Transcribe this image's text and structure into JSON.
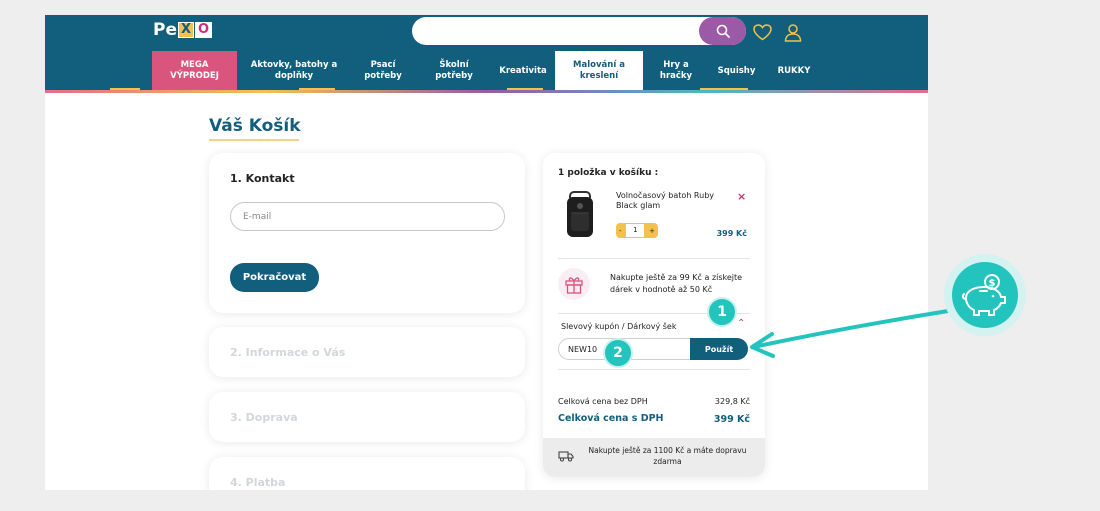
{
  "brand": {
    "logo_p": "Pe",
    "logo_x": "X",
    "logo_o": "O",
    "colors": {
      "primary": "#115e7d",
      "accent_pink": "#d9557d",
      "search_purple": "#9b5aa5",
      "yellow": "#f2c14e",
      "annotation_teal": "#24c4be"
    }
  },
  "header": {
    "search": {
      "placeholder": "",
      "icon": "search-icon"
    },
    "icons": [
      "heart-icon",
      "user-icon"
    ]
  },
  "nav": {
    "items": [
      {
        "label": "MEGA\nVÝPRODEJ"
      },
      {
        "label": "Aktovky, batohy a\ndoplňky"
      },
      {
        "label": "Psací\npotřeby"
      },
      {
        "label": "Školní\npotřeby"
      },
      {
        "label": "Kreativita"
      },
      {
        "label": "Malování a\nkreslení"
      },
      {
        "label": "Hry a\nhračky"
      },
      {
        "label": "Squishy"
      },
      {
        "label": "RUKKY"
      }
    ],
    "active_index": 5
  },
  "page": {
    "title": "Váš Košík"
  },
  "checkout": {
    "contact": {
      "title": "1. Kontakt",
      "email_placeholder": "E-mail",
      "continue_label": "Pokračovat"
    },
    "steps": [
      {
        "title": "2. Informace o Vás"
      },
      {
        "title": "3. Doprava"
      },
      {
        "title": "4. Platba"
      }
    ]
  },
  "cart": {
    "heading": "1 položka v košíku :",
    "item": {
      "name": "Volnočasový batoh Ruby Black glam",
      "qty": "1",
      "minus": "-",
      "plus": "+",
      "price": "399 Kč",
      "remove": "×"
    },
    "gift_text": "Nakupte ještě za 99 Kč a získejte dárek v hodnotě až 50 Kč",
    "coupon": {
      "label": "Slevový kupón / Dárkový šek",
      "value": "NEW10",
      "apply_label": "Použít"
    },
    "summary": {
      "net_label": "Celková cena bez DPH",
      "net_value": "329,8 Kč",
      "total_label": "Celková cena s DPH",
      "total_value": "399 Kč"
    },
    "shipping_text": "Nakupte ještě za 1100 Kč a máte dopravu zdarma"
  },
  "annotations": {
    "badge1": "1",
    "badge2": "2",
    "piggy_icon": "piggy-bank-icon"
  }
}
